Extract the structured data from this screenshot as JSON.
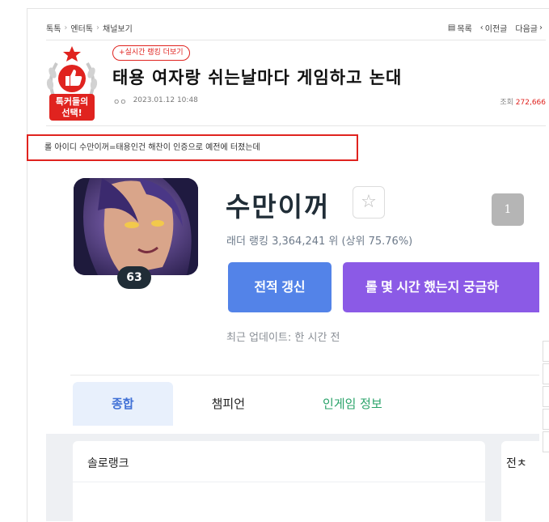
{
  "breadcrumb": [
    "톡톡",
    "엔터톡",
    "채널보기"
  ],
  "nav": {
    "list_label": "목록",
    "prev_label": "이전글",
    "next_label": "다음글"
  },
  "badge": {
    "text_line1": "톡커들의",
    "text_line2": "선택!"
  },
  "live_ranking_label": "+실시간 랭킹 더보기",
  "post": {
    "title": "태용 여자랑 쉬는날마다 게임하고 논대",
    "date": "2023.01.12 10:48",
    "author_dots": "ㅇㅇ",
    "views_label": "조회",
    "views_count": "272,666"
  },
  "quote_text": "롤 아이디 수만이꺼=태용인건 해찬이 인증으로 예전에 터졌는데",
  "profile": {
    "summoner_name": "수만이꺼",
    "level": "63",
    "ladder_rank": "래더 랭킹 3,364,241 위 (상위 75.76%)",
    "renew_button": "전적 갱신",
    "curious_button": "롤 몇 시간 했는지 궁금하",
    "last_updated": "최근 업데이트: 한 시간 전",
    "grey_box_label": "1"
  },
  "tabs": [
    "종합",
    "챔피언",
    "인게임 정보"
  ],
  "solo_rank_title": "솔로랭크",
  "second_card_title": "전ㅊ",
  "colors": {
    "accent_red": "#e0231f",
    "renew_blue": "#5383e8",
    "purple": "#8b5ae6",
    "tab_active": "#4171d6",
    "ingame_green": "#2aa36a"
  }
}
